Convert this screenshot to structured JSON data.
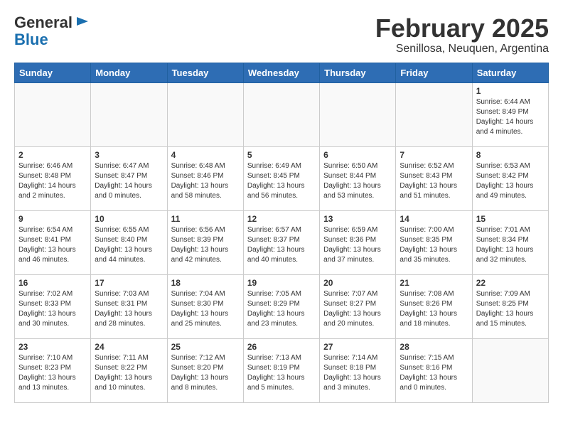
{
  "header": {
    "logo_general": "General",
    "logo_blue": "Blue",
    "month_title": "February 2025",
    "location": "Senillosa, Neuquen, Argentina"
  },
  "weekdays": [
    "Sunday",
    "Monday",
    "Tuesday",
    "Wednesday",
    "Thursday",
    "Friday",
    "Saturday"
  ],
  "weeks": [
    [
      {
        "day": "",
        "info": ""
      },
      {
        "day": "",
        "info": ""
      },
      {
        "day": "",
        "info": ""
      },
      {
        "day": "",
        "info": ""
      },
      {
        "day": "",
        "info": ""
      },
      {
        "day": "",
        "info": ""
      },
      {
        "day": "1",
        "info": "Sunrise: 6:44 AM\nSunset: 8:49 PM\nDaylight: 14 hours\nand 4 minutes."
      }
    ],
    [
      {
        "day": "2",
        "info": "Sunrise: 6:46 AM\nSunset: 8:48 PM\nDaylight: 14 hours\nand 2 minutes."
      },
      {
        "day": "3",
        "info": "Sunrise: 6:47 AM\nSunset: 8:47 PM\nDaylight: 14 hours\nand 0 minutes."
      },
      {
        "day": "4",
        "info": "Sunrise: 6:48 AM\nSunset: 8:46 PM\nDaylight: 13 hours\nand 58 minutes."
      },
      {
        "day": "5",
        "info": "Sunrise: 6:49 AM\nSunset: 8:45 PM\nDaylight: 13 hours\nand 56 minutes."
      },
      {
        "day": "6",
        "info": "Sunrise: 6:50 AM\nSunset: 8:44 PM\nDaylight: 13 hours\nand 53 minutes."
      },
      {
        "day": "7",
        "info": "Sunrise: 6:52 AM\nSunset: 8:43 PM\nDaylight: 13 hours\nand 51 minutes."
      },
      {
        "day": "8",
        "info": "Sunrise: 6:53 AM\nSunset: 8:42 PM\nDaylight: 13 hours\nand 49 minutes."
      }
    ],
    [
      {
        "day": "9",
        "info": "Sunrise: 6:54 AM\nSunset: 8:41 PM\nDaylight: 13 hours\nand 46 minutes."
      },
      {
        "day": "10",
        "info": "Sunrise: 6:55 AM\nSunset: 8:40 PM\nDaylight: 13 hours\nand 44 minutes."
      },
      {
        "day": "11",
        "info": "Sunrise: 6:56 AM\nSunset: 8:39 PM\nDaylight: 13 hours\nand 42 minutes."
      },
      {
        "day": "12",
        "info": "Sunrise: 6:57 AM\nSunset: 8:37 PM\nDaylight: 13 hours\nand 40 minutes."
      },
      {
        "day": "13",
        "info": "Sunrise: 6:59 AM\nSunset: 8:36 PM\nDaylight: 13 hours\nand 37 minutes."
      },
      {
        "day": "14",
        "info": "Sunrise: 7:00 AM\nSunset: 8:35 PM\nDaylight: 13 hours\nand 35 minutes."
      },
      {
        "day": "15",
        "info": "Sunrise: 7:01 AM\nSunset: 8:34 PM\nDaylight: 13 hours\nand 32 minutes."
      }
    ],
    [
      {
        "day": "16",
        "info": "Sunrise: 7:02 AM\nSunset: 8:33 PM\nDaylight: 13 hours\nand 30 minutes."
      },
      {
        "day": "17",
        "info": "Sunrise: 7:03 AM\nSunset: 8:31 PM\nDaylight: 13 hours\nand 28 minutes."
      },
      {
        "day": "18",
        "info": "Sunrise: 7:04 AM\nSunset: 8:30 PM\nDaylight: 13 hours\nand 25 minutes."
      },
      {
        "day": "19",
        "info": "Sunrise: 7:05 AM\nSunset: 8:29 PM\nDaylight: 13 hours\nand 23 minutes."
      },
      {
        "day": "20",
        "info": "Sunrise: 7:07 AM\nSunset: 8:27 PM\nDaylight: 13 hours\nand 20 minutes."
      },
      {
        "day": "21",
        "info": "Sunrise: 7:08 AM\nSunset: 8:26 PM\nDaylight: 13 hours\nand 18 minutes."
      },
      {
        "day": "22",
        "info": "Sunrise: 7:09 AM\nSunset: 8:25 PM\nDaylight: 13 hours\nand 15 minutes."
      }
    ],
    [
      {
        "day": "23",
        "info": "Sunrise: 7:10 AM\nSunset: 8:23 PM\nDaylight: 13 hours\nand 13 minutes."
      },
      {
        "day": "24",
        "info": "Sunrise: 7:11 AM\nSunset: 8:22 PM\nDaylight: 13 hours\nand 10 minutes."
      },
      {
        "day": "25",
        "info": "Sunrise: 7:12 AM\nSunset: 8:20 PM\nDaylight: 13 hours\nand 8 minutes."
      },
      {
        "day": "26",
        "info": "Sunrise: 7:13 AM\nSunset: 8:19 PM\nDaylight: 13 hours\nand 5 minutes."
      },
      {
        "day": "27",
        "info": "Sunrise: 7:14 AM\nSunset: 8:18 PM\nDaylight: 13 hours\nand 3 minutes."
      },
      {
        "day": "28",
        "info": "Sunrise: 7:15 AM\nSunset: 8:16 PM\nDaylight: 13 hours\nand 0 minutes."
      },
      {
        "day": "",
        "info": ""
      }
    ]
  ]
}
